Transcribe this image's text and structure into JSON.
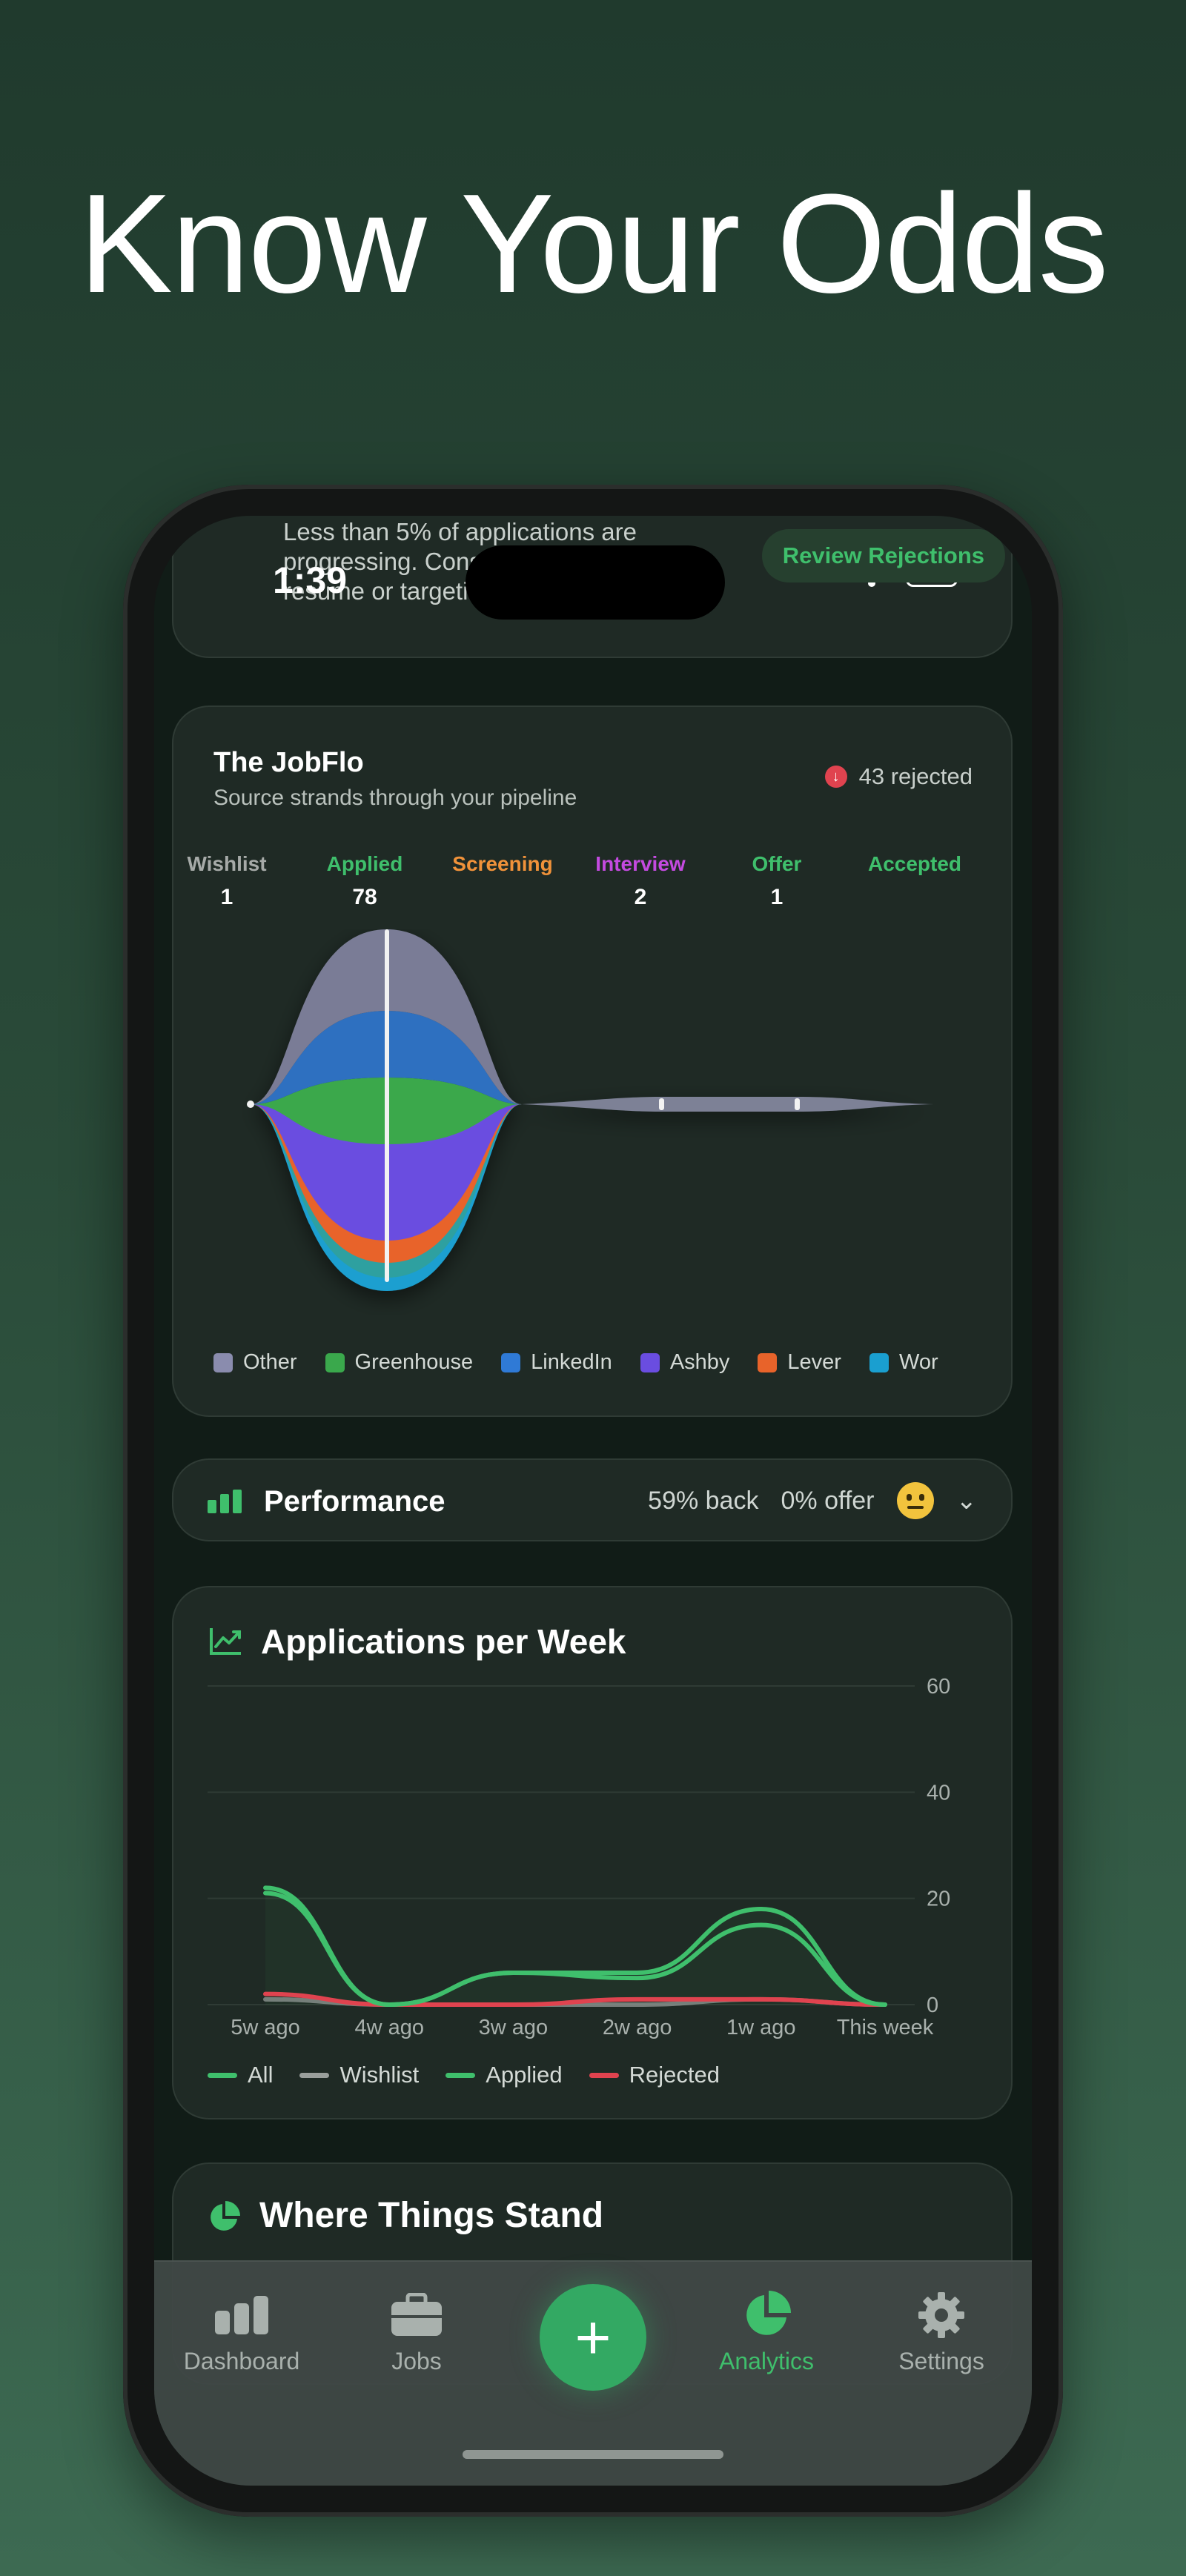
{
  "headline": "Know Your Odds",
  "status": {
    "time": "1:39"
  },
  "alert": {
    "text": "Less than 5% of applications are progressing. Consider updating your resume or targeting different roles.",
    "button": "Review Rejections"
  },
  "jobflo": {
    "title": "The JobFlo",
    "subtitle": "Source strands through your pipeline",
    "rejected": "43 rejected",
    "stages": [
      {
        "name": "Wishlist",
        "count": "1",
        "color": "#a6aaa8"
      },
      {
        "name": "Applied",
        "count": "78",
        "color": "#3fbf6c"
      },
      {
        "name": "Screening",
        "count": "",
        "color": "#f0923a"
      },
      {
        "name": "Interview",
        "count": "2",
        "color": "#c44ae0"
      },
      {
        "name": "Offer",
        "count": "1",
        "color": "#3fbf6c"
      },
      {
        "name": "Accepted",
        "count": "",
        "color": "#3fbf6c"
      }
    ],
    "sources": [
      {
        "name": "Other",
        "color": "#8a8cae"
      },
      {
        "name": "Greenhouse",
        "color": "#3aa84c"
      },
      {
        "name": "LinkedIn",
        "color": "#2f7ad6"
      },
      {
        "name": "Ashby",
        "color": "#6a4de0"
      },
      {
        "name": "Lever",
        "color": "#e8632a"
      },
      {
        "name": "Wor",
        "color": "#1a9fd0"
      }
    ]
  },
  "performance": {
    "title": "Performance",
    "back": "59% back",
    "offer": "0% offer"
  },
  "apw": {
    "title": "Applications per Week",
    "y_ticks": [
      "60",
      "40",
      "20",
      "0"
    ],
    "legend": [
      {
        "name": "All",
        "color": "#3fbf6c"
      },
      {
        "name": "Wishlist",
        "color": "#9a9f9c"
      },
      {
        "name": "Applied",
        "color": "#3fbf6c"
      },
      {
        "name": "Rejected",
        "color": "#e0434f"
      }
    ]
  },
  "chart_data": {
    "type": "line",
    "title": "Applications per Week",
    "x": [
      "5w ago",
      "4w ago",
      "3w ago",
      "2w ago",
      "1w ago",
      "This week"
    ],
    "ylim": [
      0,
      60
    ],
    "y_ticks": [
      0,
      20,
      40,
      60
    ],
    "grid": true,
    "legend_position": "bottom",
    "series": [
      {
        "name": "All",
        "color": "#3fbf6c",
        "values": [
          22,
          0,
          6,
          6,
          18,
          0
        ]
      },
      {
        "name": "Wishlist",
        "color": "#9a9f9c",
        "values": [
          1,
          0,
          0,
          0,
          1,
          0
        ]
      },
      {
        "name": "Applied",
        "color": "#3fbf6c",
        "values": [
          21,
          0,
          6,
          5,
          15,
          0
        ]
      },
      {
        "name": "Rejected",
        "color": "#e0434f",
        "values": [
          2,
          0,
          0,
          1,
          1,
          0
        ]
      }
    ]
  },
  "where": {
    "title": "Where Things Stand"
  },
  "tabs": [
    {
      "label": "Dashboard"
    },
    {
      "label": "Jobs"
    },
    {
      "label": "Analytics"
    },
    {
      "label": "Settings"
    }
  ],
  "fab": "+"
}
